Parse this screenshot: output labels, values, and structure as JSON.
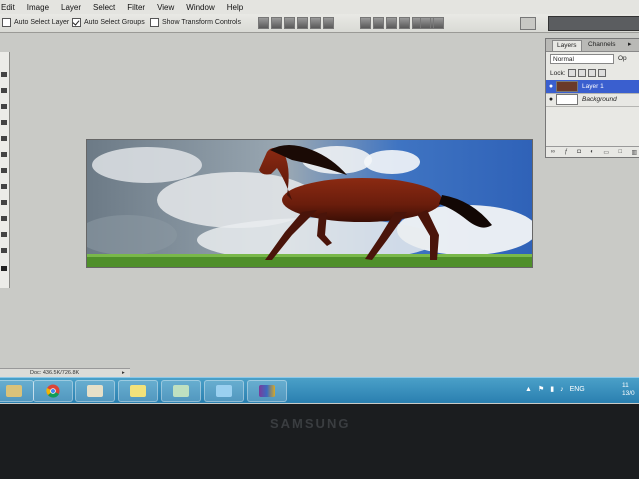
{
  "menubar": {
    "items": [
      "Edit",
      "Image",
      "Layer",
      "Select",
      "Filter",
      "View",
      "Window",
      "Help"
    ]
  },
  "options": {
    "auto_select_layer": "Auto Select Layer",
    "auto_select_groups": "Auto Select Groups",
    "show_transform_controls": "Show Transform Controls"
  },
  "layers_panel": {
    "tab_layers": "Layers",
    "tab_channels": "Channels",
    "blend_mode": "Normal",
    "opacity_label": "Op",
    "lock_label": "Lock:",
    "layers": [
      {
        "name": "Layer 1",
        "selected": true
      },
      {
        "name": "Background",
        "selected": false
      }
    ]
  },
  "status": {
    "doc_size": "Doc: 436.5K/726.8K"
  },
  "tray": {
    "language": "ENG",
    "clock_line1": "11",
    "clock_line2": "13/0"
  },
  "monitor": {
    "brand": "SAMSUNG"
  },
  "colors": {
    "selection": "#3a5fcf",
    "taskbar": "#2a7fb0",
    "workspace": "#c9cac6"
  }
}
